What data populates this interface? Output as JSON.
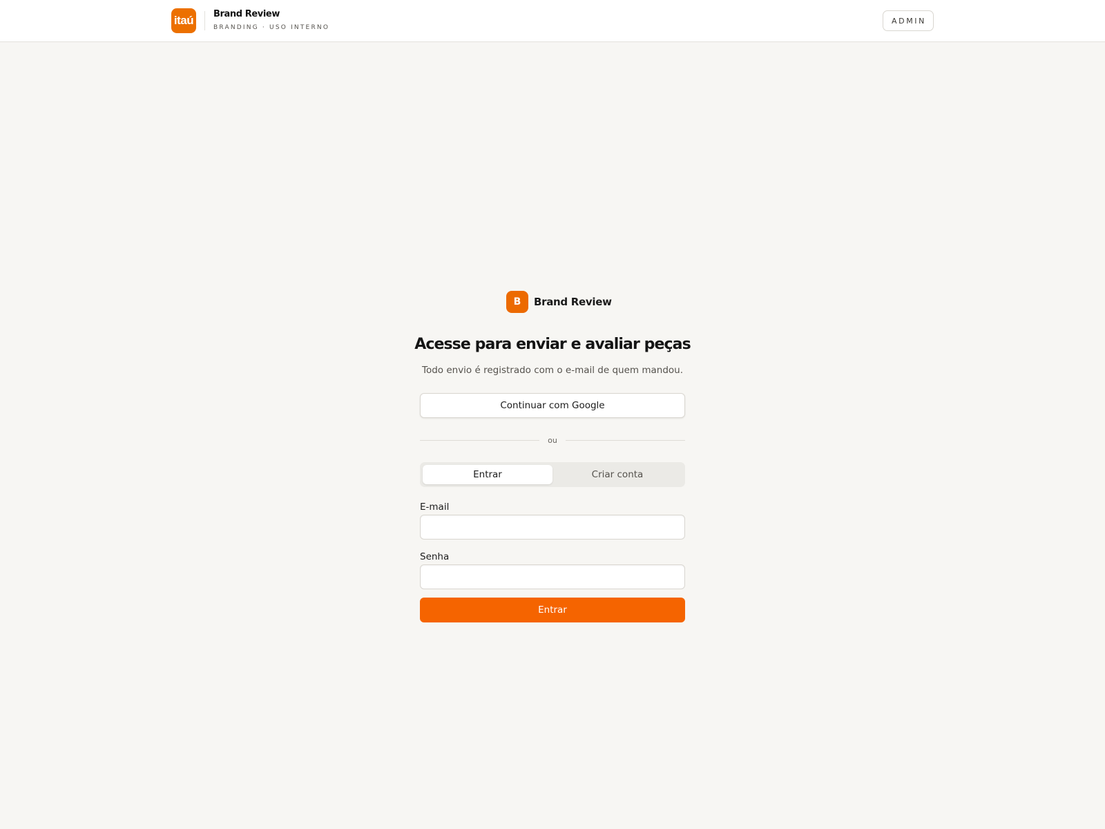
{
  "header": {
    "logo_text": "itaú",
    "brand_title": "Brand Review",
    "brand_subtitle": "BRANDING · USO INTERNO",
    "admin_button": "ADMIN"
  },
  "login": {
    "logo_letter": "B",
    "brand_name": "Brand Review",
    "heading": "Acesse para enviar e avaliar peças",
    "subheading": "Todo envio é registrado com o e-mail de quem mandou.",
    "google_button": "Continuar com Google",
    "divider_text": "ou",
    "tabs": [
      {
        "label": "Entrar",
        "active": true
      },
      {
        "label": "Criar conta",
        "active": false
      }
    ],
    "email_label": "E-mail",
    "email_value": "",
    "password_label": "Senha",
    "password_value": "",
    "submit_button": "Entrar"
  },
  "colors": {
    "accent": "#ec7000",
    "background": "#f7f6f3"
  }
}
